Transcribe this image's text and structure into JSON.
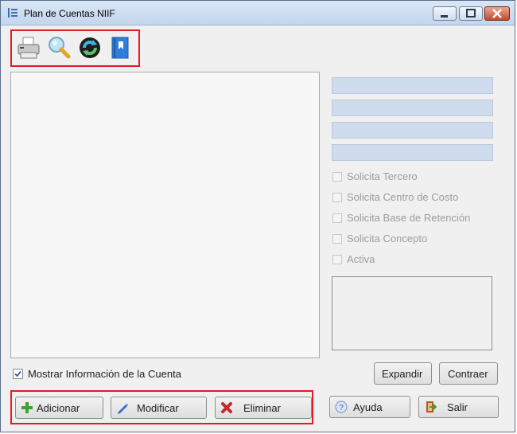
{
  "window": {
    "title": "Plan de Cuentas NIIF",
    "icons": [
      "app-list-icon",
      "minimize-icon",
      "maximize-icon",
      "close-icon"
    ]
  },
  "toolbar": {
    "buttons": [
      {
        "icon": "printer-icon"
      },
      {
        "icon": "search-icon"
      },
      {
        "icon": "refresh-icon"
      },
      {
        "icon": "book-icon"
      }
    ]
  },
  "options": {
    "checkboxes": [
      {
        "label": "Solicita Tercero",
        "checked": false
      },
      {
        "label": "Solicita Centro de Costo",
        "checked": false
      },
      {
        "label": "Solicita Base de Retención",
        "checked": false
      },
      {
        "label": "Solicita Concepto",
        "checked": false
      },
      {
        "label": "Activa",
        "checked": false
      }
    ]
  },
  "footer": {
    "show_info_label": "Mostrar Información de la Cuenta",
    "show_info_checked": true,
    "expand_label": "Expandir",
    "collapse_label": "Contraer",
    "add_label": "Adicionar",
    "modify_label": "Modificar",
    "delete_label": "Eliminar",
    "help_label": "Ayuda",
    "exit_label": "Salir"
  },
  "colors": {
    "highlight": "#e21b24",
    "field_bg": "#cfdcee",
    "window_bg": "#f0f0f0"
  }
}
